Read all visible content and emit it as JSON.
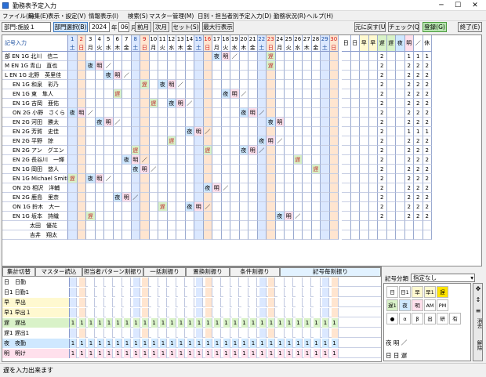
{
  "window": {
    "title": "勤務表予定入力",
    "minimize": "─",
    "maximize": "☐",
    "close": "✕"
  },
  "menu": [
    "ファイル(F)",
    "編集(E)",
    "表示・設定(V)",
    "情報表示(I)",
    "検索(S)",
    "マスター管理(M)",
    "日別・担当者別予定入力(D)",
    "勤務状況(R)",
    "ヘルプ(H)"
  ],
  "toolbar": {
    "dept_label": "部門:",
    "dept_value": "施設１",
    "dept_select": "部門選択(B)",
    "year": "2024",
    "year_label": "年",
    "month": "06",
    "month_label": "月度",
    "prev": "前月",
    "next": "次月",
    "set": "セット(S)",
    "maxrows": "最大行表示",
    "undo": "元に戻す(U)",
    "check": "チェック(Q)",
    "register": "登録(G)",
    "exit": "終了(E)"
  },
  "grid": {
    "header_label": "記号入力",
    "days": [
      {
        "d": "1",
        "w": "土"
      },
      {
        "d": "2",
        "w": "日"
      },
      {
        "d": "3",
        "w": "月"
      },
      {
        "d": "4",
        "w": "火"
      },
      {
        "d": "5",
        "w": "水"
      },
      {
        "d": "6",
        "w": "木"
      },
      {
        "d": "7",
        "w": "金"
      },
      {
        "d": "8",
        "w": "土"
      },
      {
        "d": "9",
        "w": "日"
      },
      {
        "d": "10",
        "w": "月"
      },
      {
        "d": "11",
        "w": "火"
      },
      {
        "d": "12",
        "w": "水"
      },
      {
        "d": "13",
        "w": "木"
      },
      {
        "d": "14",
        "w": "金"
      },
      {
        "d": "15",
        "w": "土"
      },
      {
        "d": "16",
        "w": "日"
      },
      {
        "d": "17",
        "w": "月"
      },
      {
        "d": "18",
        "w": "火"
      },
      {
        "d": "19",
        "w": "水"
      },
      {
        "d": "20",
        "w": "木"
      },
      {
        "d": "21",
        "w": "金"
      },
      {
        "d": "22",
        "w": "土"
      },
      {
        "d": "23",
        "w": "日"
      },
      {
        "d": "24",
        "w": "月"
      },
      {
        "d": "25",
        "w": "火"
      },
      {
        "d": "26",
        "w": "水"
      },
      {
        "d": "27",
        "w": "木"
      },
      {
        "d": "28",
        "w": "金"
      },
      {
        "d": "29",
        "w": "土"
      },
      {
        "d": "30",
        "w": "日"
      }
    ],
    "summary_headers": [
      "日",
      "日1",
      "早",
      "早1",
      "遅",
      "遅1",
      "夜",
      "明",
      "／",
      "休"
    ],
    "staff": [
      {
        "name": "部 EN 1G 北川　信二",
        "shifts": {
          "17": "夜",
          "18": "明",
          "19": "／",
          "23": "遅"
        },
        "sum": [
          "",
          "",
          "",
          "",
          "2",
          "",
          "",
          "1",
          "1",
          "1"
        ]
      },
      {
        "name": "M EN 1G 青山　直也",
        "shifts": {
          "3": "夜",
          "4": "明",
          "5": "／",
          "23": "遅"
        },
        "sum": [
          "",
          "",
          "",
          "",
          "2",
          "",
          "",
          "2",
          "2",
          "2"
        ]
      },
      {
        "name": "L EN 1G 北野　英里佳",
        "shifts": {
          "5": "夜",
          "6": "明",
          "7": "／"
        },
        "sum": [
          "",
          "",
          "",
          "",
          "2",
          "",
          "",
          "2",
          "2",
          "2"
        ]
      },
      {
        "name": "EN 1G 和泉　彩乃",
        "shifts": {
          "9": "遅",
          "11": "夜",
          "12": "明",
          "13": "／"
        },
        "sum": [
          "",
          "",
          "",
          "",
          "2",
          "",
          "",
          "2",
          "2",
          "2"
        ]
      },
      {
        "name": "EN 1G 東　隼人",
        "shifts": {
          "6": "遅",
          "18": "夜",
          "19": "明",
          "20": "／"
        },
        "sum": [
          "",
          "",
          "",
          "",
          "2",
          "",
          "",
          "2",
          "2",
          "2"
        ]
      },
      {
        "name": "EN 1G 吉岡　亜佑",
        "shifts": {
          "10": "遅",
          "12": "夜",
          "13": "明",
          "14": "／"
        },
        "sum": [
          "",
          "",
          "",
          "",
          "2",
          "",
          "",
          "2",
          "2",
          "2"
        ]
      },
      {
        "name": "ON 2G 小野　さくら",
        "shifts": {
          "1": "夜",
          "2": "明",
          "3": "／",
          "20": "夜",
          "21": "明",
          "22": "／"
        },
        "sum": [
          "",
          "",
          "",
          "",
          "2",
          "",
          "",
          "2",
          "2",
          "2"
        ]
      },
      {
        "name": "EN 2G 河田　勝太",
        "shifts": {
          "4": "夜",
          "5": "明",
          "6": "／",
          "23": "夜",
          "24": "明"
        },
        "sum": [
          "",
          "",
          "",
          "",
          "2",
          "",
          "",
          "2",
          "2",
          "2"
        ]
      },
      {
        "name": "EN 2G 芳賀　史佳",
        "shifts": {
          "14": "夜",
          "15": "明",
          "16": "／"
        },
        "sum": [
          "",
          "",
          "",
          "",
          "2",
          "",
          "",
          "1",
          "1",
          "1"
        ]
      },
      {
        "name": "EN 2G 平野　諒",
        "shifts": {
          "12": "遅",
          "22": "夜",
          "23": "明",
          "24": "／"
        },
        "sum": [
          "",
          "",
          "",
          "",
          "2",
          "",
          "",
          "2",
          "2",
          "2"
        ]
      },
      {
        "name": "EN 2G アン　グエン",
        "shifts": {
          "8": "遅",
          "16": "遅",
          "20": "夜",
          "21": "明",
          "22": "／"
        },
        "sum": [
          "",
          "",
          "",
          "",
          "2",
          "",
          "",
          "2",
          "2",
          "2"
        ]
      },
      {
        "name": "EN 2G 長谷川　一輝",
        "shifts": {
          "7": "夜",
          "8": "明",
          "9": "／",
          "26": "遅"
        },
        "sum": [
          "",
          "",
          "",
          "",
          "2",
          "",
          "",
          "2",
          "2",
          "2"
        ]
      },
      {
        "name": "EN 1G 岡田　悠人",
        "shifts": {
          "8": "夜",
          "9": "明",
          "10": "／",
          "28": "遅"
        },
        "sum": [
          "",
          "",
          "",
          "",
          "2",
          "",
          "",
          "2",
          "2",
          "2"
        ]
      },
      {
        "name": "EN 1G Michael Smith",
        "shifts": {
          "1": "遅",
          "3": "夜",
          "4": "明",
          "5": "／"
        },
        "sum": [
          "",
          "",
          "",
          "",
          "2",
          "",
          "",
          "2",
          "2",
          "2"
        ]
      },
      {
        "name": "ON 2G 相沢　洋輔",
        "shifts": {
          "16": "夜",
          "17": "明",
          "18": "／"
        },
        "sum": [
          "",
          "",
          "",
          "",
          "2",
          "",
          "",
          "2",
          "2",
          "2"
        ]
      },
      {
        "name": "EN 2G 鹿島　里奈",
        "shifts": {
          "6": "夜",
          "7": "明",
          "8": "／"
        },
        "sum": [
          "",
          "",
          "",
          "",
          "2",
          "",
          "",
          "2",
          "2",
          "2"
        ]
      },
      {
        "name": "ON 1G 鈴木　大一",
        "shifts": {
          "11": "遅",
          "14": "夜",
          "15": "明",
          "16": "／"
        },
        "sum": [
          "",
          "",
          "",
          "",
          "2",
          "",
          "",
          "2",
          "2",
          "2"
        ]
      },
      {
        "name": "EN 1G 坂本　詩織",
        "shifts": {
          "3": "遅",
          "24": "夜",
          "25": "明",
          "26": "／"
        },
        "sum": [
          "",
          "",
          "",
          "",
          "2",
          "",
          "",
          "2",
          "2",
          "2"
        ]
      },
      {
        "name": "太田　優花",
        "shifts": {},
        "sum": [
          "",
          "",
          "",
          "",
          "",
          "",
          "",
          "",
          "",
          ""
        ]
      },
      {
        "name": "吉井　翔太",
        "shifts": {},
        "sum": [
          "",
          "",
          "",
          "",
          "",
          "",
          "",
          "",
          "",
          ""
        ]
      }
    ]
  },
  "tabs": [
    "集計切替",
    "マスター読込",
    "担当者パターン割振り",
    "一括割振り",
    "置換割振り",
    "条件割振り",
    "記号毎割振り"
  ],
  "summary_rows": [
    {
      "label": "日　日勤",
      "color": "#ffffff",
      "val": ""
    },
    {
      "label": "日1 日勤1",
      "color": "#ffffff",
      "val": ""
    },
    {
      "label": "早　早出",
      "color": "#fff9d0",
      "val": ""
    },
    {
      "label": "早1 早出１",
      "color": "#fff9d0",
      "val": ""
    },
    {
      "label": "遅　遅出",
      "color": "#d9f2c8",
      "val": "1"
    },
    {
      "label": "遅1 遅出1",
      "color": "#ffffff",
      "val": ""
    },
    {
      "label": "夜　夜勤",
      "color": "#cfe8ff",
      "val": "1"
    },
    {
      "label": "明　明け",
      "color": "#ffe0ec",
      "val": "1"
    }
  ],
  "palette": {
    "category_label": "記号分類",
    "category_value": "指定なし",
    "row1": [
      "日",
      "日1",
      "早",
      "早1",
      "遅"
    ],
    "row2": [
      "遅1",
      "夜",
      "明",
      "AM",
      "PM"
    ],
    "row3": [
      "●",
      "α",
      "β",
      "出",
      "研"
    ],
    "row4": [
      "有"
    ],
    "line1": "夜 明 ／",
    "line2": "日 日 遅"
  },
  "side_buttons": [
    "消去",
    "解除"
  ],
  "status": "遅を入力出来ます",
  "colors": {
    "night": "#cfe8ff",
    "after": "#ffe0ec",
    "late": "#d9f2c8",
    "sat": "#dbe8ff",
    "sun": "#ffe5d0"
  }
}
